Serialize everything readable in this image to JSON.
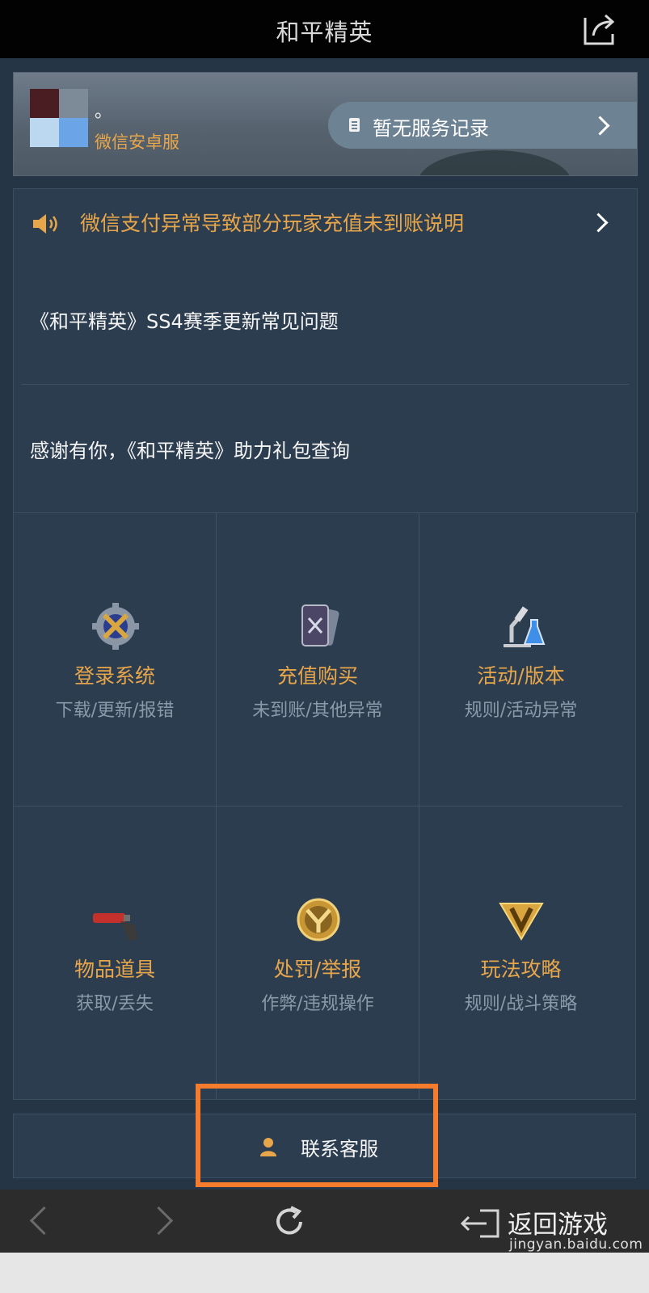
{
  "header": {
    "title": "和平精英"
  },
  "profile": {
    "nickname": "。",
    "server": "微信安卓服",
    "record_label": "暂无服务记录"
  },
  "notice": {
    "text": "微信支付异常导致部分玩家充值未到账说明"
  },
  "faq": {
    "items": [
      {
        "label": "《和平精英》SS4赛季更新常见问题"
      },
      {
        "label": "感谢有你，《和平精英》助力礼包查询"
      }
    ]
  },
  "categories": [
    {
      "title": "登录系统",
      "subtitle": "下载/更新/报错",
      "icon": "gear-icon"
    },
    {
      "title": "充值购买",
      "subtitle": "未到账/其他异常",
      "icon": "card-icon"
    },
    {
      "title": "活动/版本",
      "subtitle": "规则/活动异常",
      "icon": "microscope-icon"
    },
    {
      "title": "物品道具",
      "subtitle": "获取/丢失",
      "icon": "flare-gun-icon"
    },
    {
      "title": "处罚/举报",
      "subtitle": "作弊/违规操作",
      "icon": "emblem-icon"
    },
    {
      "title": "玩法攻略",
      "subtitle": "规则/战斗策略",
      "icon": "v-badge-icon"
    }
  ],
  "contact": {
    "label": "联系客服"
  },
  "bottom_nav": {
    "return_label": "返回游戏"
  },
  "watermark": {
    "url": "jingyan.baidu.com"
  },
  "colors": {
    "accent": "#e8a64a",
    "highlight": "#f47c2c",
    "background": "#263546"
  }
}
